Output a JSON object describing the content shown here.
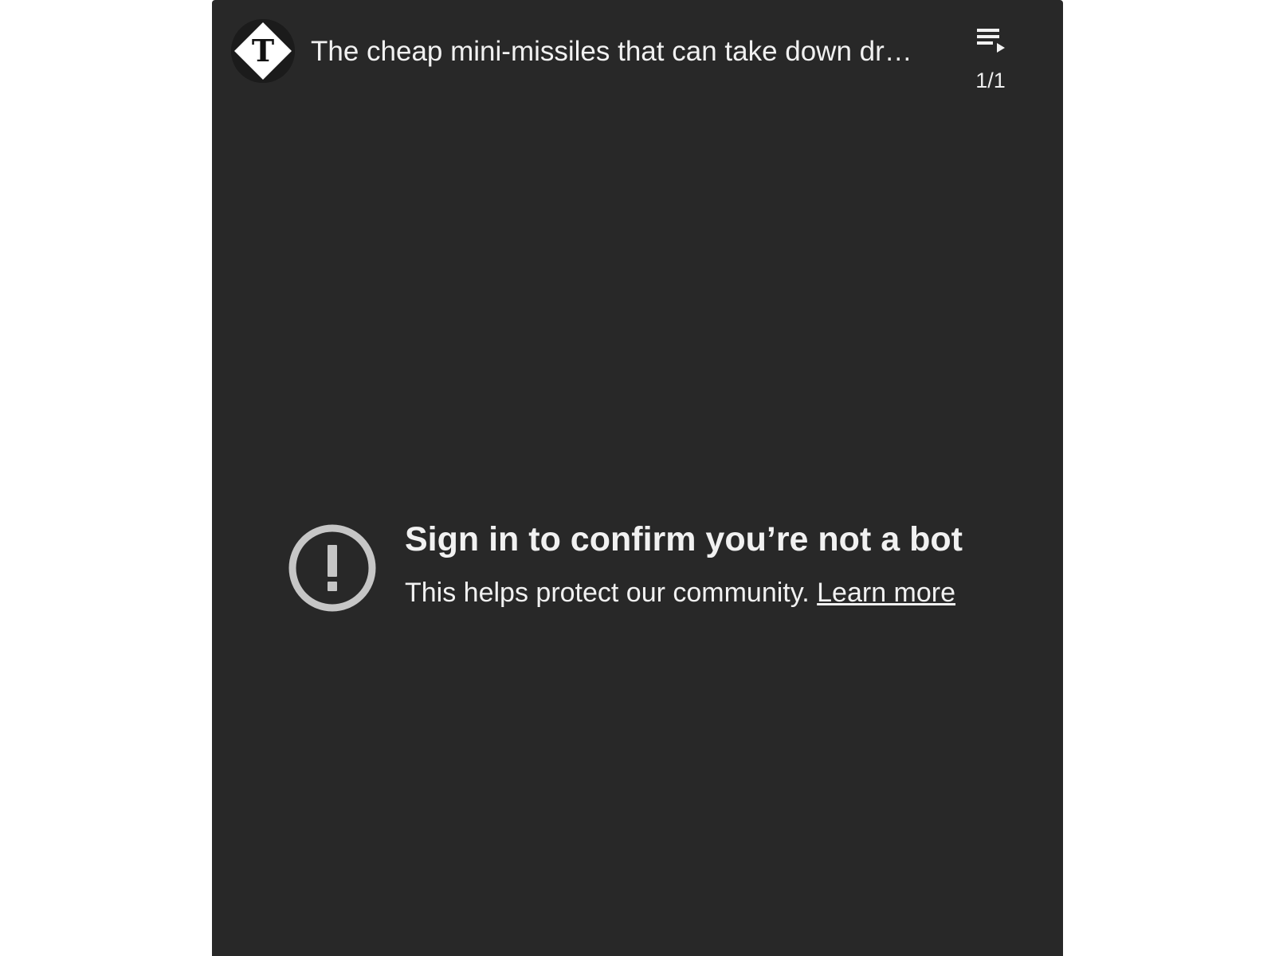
{
  "header": {
    "channel_logo_letter": "T",
    "video_title": "The cheap mini-missiles that can take down dr…",
    "playlist_icon": "playlist-play-icon",
    "playlist_count": "1/1"
  },
  "error": {
    "icon": "alert-circle-icon",
    "title": "Sign in to confirm you’re not a bot",
    "message": "This helps protect our community.",
    "link_label": "Learn more"
  },
  "colors": {
    "player_background": "#282828",
    "text": "#f1f1f1",
    "icon_gray": "#c6c6c6"
  }
}
